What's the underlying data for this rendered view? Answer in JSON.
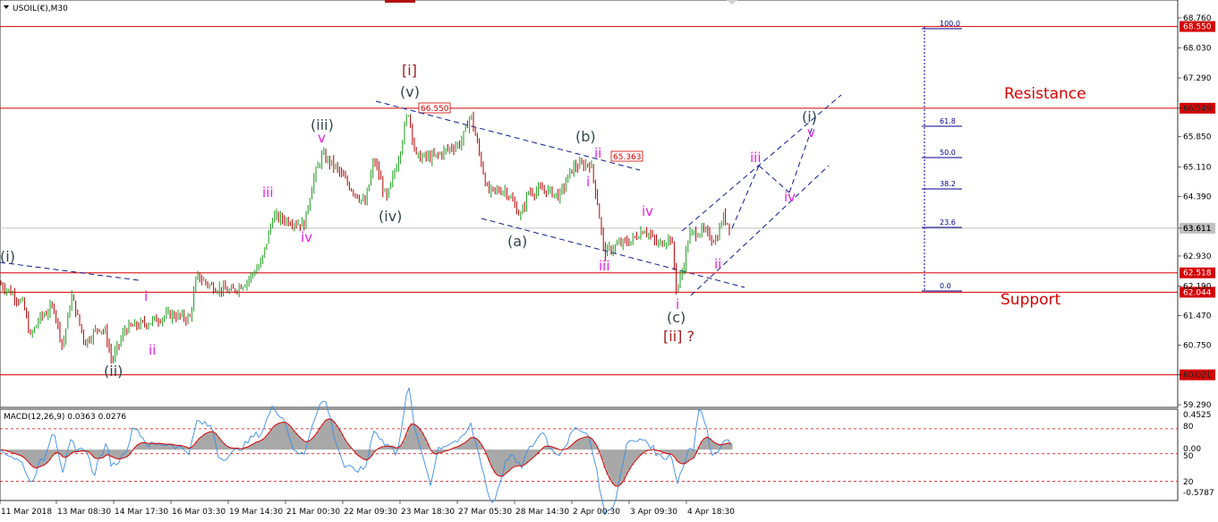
{
  "header": {
    "symbol_label": "USOIL(€),M30"
  },
  "macd": {
    "label": "MACD(12,26,9) 0.0363 0.0276",
    "scale_labels": [
      "0.4525",
      "80",
      "0.00",
      "50",
      "20",
      "-0.5787"
    ]
  },
  "chart_data": {
    "type": "candlestick",
    "title": "USOIL(€),M30",
    "price_ylim": [
      59.36,
      68.76
    ],
    "price_ticks": [
      "68.760",
      "68.030",
      "67.290",
      "66.549",
      "65.850",
      "65.110",
      "64.390",
      "63.611",
      "62.930",
      "62.190",
      "61.470",
      "60.750",
      "60.021",
      "59.290"
    ],
    "x_tick_labels": [
      "11 Mar 2018",
      "13 Mar 08:30",
      "14 Mar 17:30",
      "16 Mar 03:30",
      "19 Mar 14:30",
      "21 Mar 00:30",
      "22 Mar 09:30",
      "23 Mar 18:30",
      "27 Mar 05:30",
      "28 Mar 14:30",
      "2 Apr 00:30",
      "3 Apr 09:30",
      "4 Apr 18:30"
    ],
    "price_path": [
      [
        0,
        62.25
      ],
      [
        12,
        62.05
      ],
      [
        26,
        61.75
      ],
      [
        34,
        60.95
      ],
      [
        44,
        61.4
      ],
      [
        60,
        61.7
      ],
      [
        70,
        60.7
      ],
      [
        80,
        61.95
      ],
      [
        95,
        60.8
      ],
      [
        110,
        61.2
      ],
      [
        118,
        61.05
      ],
      [
        125,
        60.35
      ],
      [
        140,
        61.15
      ],
      [
        165,
        61.3
      ],
      [
        190,
        61.5
      ],
      [
        212,
        61.4
      ],
      [
        220,
        62.45
      ],
      [
        235,
        62.2
      ],
      [
        258,
        62.05
      ],
      [
        275,
        62.3
      ],
      [
        292,
        62.75
      ],
      [
        305,
        63.9
      ],
      [
        322,
        63.8
      ],
      [
        340,
        63.7
      ],
      [
        350,
        64.8
      ],
      [
        360,
        65.4
      ],
      [
        375,
        65.1
      ],
      [
        392,
        64.6
      ],
      [
        408,
        64.2
      ],
      [
        418,
        65.3
      ],
      [
        432,
        64.3
      ],
      [
        446,
        65.4
      ],
      [
        456,
        66.5
      ],
      [
        465,
        65.35
      ],
      [
        485,
        65.35
      ],
      [
        505,
        65.6
      ],
      [
        515,
        65.7
      ],
      [
        526,
        66.4
      ],
      [
        536,
        65.4
      ],
      [
        545,
        64.5
      ],
      [
        565,
        64.55
      ],
      [
        582,
        63.9
      ],
      [
        590,
        64.5
      ],
      [
        610,
        64.55
      ],
      [
        625,
        64.4
      ],
      [
        640,
        65.1
      ],
      [
        660,
        65.2
      ],
      [
        668,
        64.2
      ],
      [
        675,
        63.0
      ],
      [
        690,
        63.2
      ],
      [
        705,
        63.3
      ],
      [
        720,
        63.6
      ],
      [
        735,
        63.2
      ],
      [
        750,
        63.4
      ],
      [
        756,
        62.1
      ],
      [
        763,
        62.6
      ],
      [
        770,
        63.45
      ],
      [
        785,
        63.55
      ],
      [
        800,
        63.3
      ],
      [
        808,
        63.9
      ],
      [
        817,
        63.61
      ]
    ],
    "horizontal_levels": [
      {
        "price": "68.550",
        "color": "#d40000"
      },
      {
        "price": "66.549",
        "color": "#d40000"
      },
      {
        "price": "63.611",
        "color": "#c0c0c0"
      },
      {
        "price": "62.518",
        "color": "#d40000"
      },
      {
        "price": "62.044",
        "color": "#d40000"
      },
      {
        "price": "60.021",
        "color": "#d40000"
      }
    ],
    "zone_labels": {
      "resistance": "Resistance",
      "support": "Support"
    },
    "price_callouts": [
      "66.550",
      "65.363"
    ],
    "fibonacci": [
      "100.0",
      "61.8",
      "50.0",
      "38.2",
      "23.6",
      "0.0"
    ],
    "wave_labels_dark": [
      "(i)",
      "(ii)",
      "(iii)",
      "(iv)",
      "(v)",
      "(a)",
      "(b)",
      "(c)",
      "(i)"
    ],
    "wave_labels_magenta": [
      "i",
      "ii",
      "iii",
      "iv",
      "v",
      "ii",
      "i",
      "iii",
      "iv",
      "i",
      "ii",
      "iii",
      "iv",
      "v"
    ],
    "wave_labels_degree": [
      "[i]",
      "[ii] ?"
    ],
    "macd_ylim": [
      -0.5787,
      0.4525
    ]
  },
  "colors": {
    "bull": "#1c9b1c",
    "bear": "#b00000",
    "level_red": "#d40000",
    "trendline": "#0a1a8c",
    "macd_signal": "#d40000",
    "macd_main": "#3a8ee6",
    "macd_hist": "#a8a8a8"
  }
}
